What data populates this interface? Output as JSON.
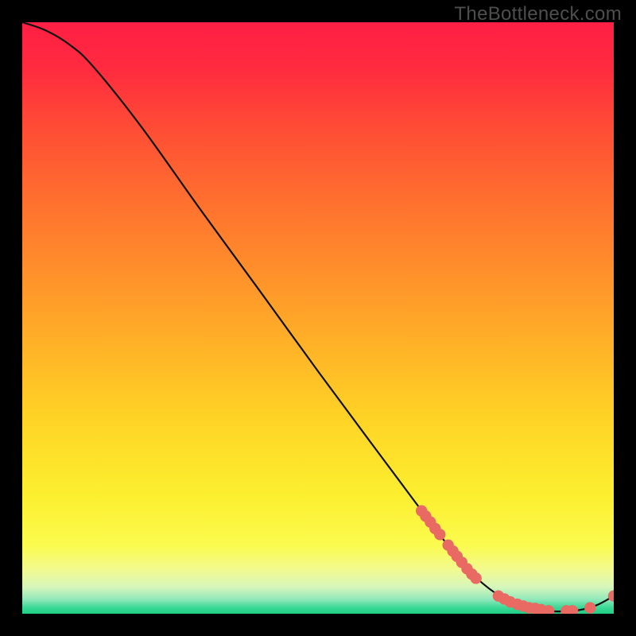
{
  "watermark": "TheBottleneck.com",
  "chart_data": {
    "type": "line",
    "title": "",
    "xlabel": "",
    "ylabel": "",
    "xlim": [
      0,
      100
    ],
    "ylim": [
      0,
      100
    ],
    "curve": [
      {
        "x": 0,
        "y": 100
      },
      {
        "x": 4,
        "y": 98.6
      },
      {
        "x": 8,
        "y": 96.2
      },
      {
        "x": 12,
        "y": 92.5
      },
      {
        "x": 20,
        "y": 82.5
      },
      {
        "x": 30,
        "y": 68.5
      },
      {
        "x": 40,
        "y": 54.8
      },
      {
        "x": 50,
        "y": 41.0
      },
      {
        "x": 60,
        "y": 27.5
      },
      {
        "x": 68,
        "y": 16.8
      },
      {
        "x": 74,
        "y": 9.0
      },
      {
        "x": 78,
        "y": 5.0
      },
      {
        "x": 82,
        "y": 2.3
      },
      {
        "x": 86,
        "y": 0.9
      },
      {
        "x": 90,
        "y": 0.4
      },
      {
        "x": 94,
        "y": 0.6
      },
      {
        "x": 97,
        "y": 1.4
      },
      {
        "x": 100,
        "y": 3.0
      }
    ],
    "points": [
      {
        "x": 67.5,
        "y": 17.4
      },
      {
        "x": 68.2,
        "y": 16.5
      },
      {
        "x": 69.0,
        "y": 15.5
      },
      {
        "x": 69.8,
        "y": 14.4
      },
      {
        "x": 70.6,
        "y": 13.4
      },
      {
        "x": 72.0,
        "y": 11.6
      },
      {
        "x": 72.8,
        "y": 10.6
      },
      {
        "x": 73.5,
        "y": 9.7
      },
      {
        "x": 74.3,
        "y": 8.7
      },
      {
        "x": 75.2,
        "y": 7.6
      },
      {
        "x": 76.0,
        "y": 6.7
      },
      {
        "x": 76.7,
        "y": 6.0
      },
      {
        "x": 80.5,
        "y": 3.0
      },
      {
        "x": 81.5,
        "y": 2.5
      },
      {
        "x": 82.5,
        "y": 2.0
      },
      {
        "x": 83.7,
        "y": 1.6
      },
      {
        "x": 84.7,
        "y": 1.3
      },
      {
        "x": 85.7,
        "y": 1.0
      },
      {
        "x": 86.7,
        "y": 0.9
      },
      {
        "x": 87.7,
        "y": 0.7
      },
      {
        "x": 89.0,
        "y": 0.5
      },
      {
        "x": 92.0,
        "y": 0.5
      },
      {
        "x": 93.0,
        "y": 0.5
      },
      {
        "x": 96.0,
        "y": 1.0
      },
      {
        "x": 100.0,
        "y": 3.0
      }
    ],
    "gradient_stops": [
      {
        "offset": 0.0,
        "color": "#ff1f44"
      },
      {
        "offset": 0.08,
        "color": "#ff2b3f"
      },
      {
        "offset": 0.18,
        "color": "#ff4d35"
      },
      {
        "offset": 0.3,
        "color": "#ff6f2f"
      },
      {
        "offset": 0.42,
        "color": "#ff8f2b"
      },
      {
        "offset": 0.55,
        "color": "#ffb327"
      },
      {
        "offset": 0.68,
        "color": "#ffd626"
      },
      {
        "offset": 0.8,
        "color": "#fcef2f"
      },
      {
        "offset": 0.885,
        "color": "#fbfb4f"
      },
      {
        "offset": 0.925,
        "color": "#f2fa8f"
      },
      {
        "offset": 0.955,
        "color": "#d6f6bb"
      },
      {
        "offset": 0.975,
        "color": "#95e9bb"
      },
      {
        "offset": 0.99,
        "color": "#38d895"
      },
      {
        "offset": 1.0,
        "color": "#1fce84"
      }
    ],
    "point_color": "#e86a62",
    "line_color": "#111111"
  }
}
